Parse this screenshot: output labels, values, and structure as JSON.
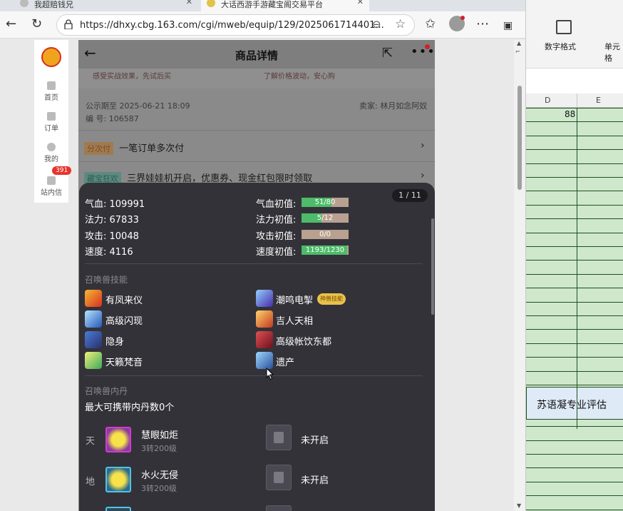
{
  "browser": {
    "tabs": [
      {
        "title": "我超赔钱兄"
      },
      {
        "title": "大话西游手游藏宝阁交易平台"
      }
    ],
    "url": "https://dhxy.cbg.163.com/cgi/mweb/equip/129/2025061714401...",
    "icons": [
      "back-icon",
      "refresh-icon",
      "lock-icon",
      "zoom-icon",
      "star-icon",
      "favorites-icon",
      "profile-icon",
      "more-icon",
      "sidebar-icon"
    ]
  },
  "leftnav": {
    "items": [
      {
        "label": "首页"
      },
      {
        "label": "订单"
      },
      {
        "label": "我的"
      },
      {
        "label": "站内信",
        "badge": "391"
      }
    ]
  },
  "page": {
    "title": "商品详情",
    "banner_left": "感受实战效果，先试后买",
    "banner_right": "了解价格波动，安心购",
    "publicity": "公示期至 2025-06-21 18:09",
    "seller": "卖家: 林月如念阿奴",
    "serial": "编 号: 106587",
    "pay_tag": "分次付",
    "pay_text": "一笔订单多次付",
    "promo_tag": "藏宝狂欢",
    "promo_text": "三界娃娃机开启，优惠券、现金红包限时领取"
  },
  "panel": {
    "counter": "1 / 11",
    "stats": [
      {
        "label": "气血: 109991",
        "init_label": "气血初值:",
        "bar": "51/80",
        "fill": 0.64
      },
      {
        "label": "法力: 67833",
        "init_label": "法力初值:",
        "bar": "5/12",
        "fill": 0.42
      },
      {
        "label": "攻击: 10048",
        "init_label": "攻击初值:",
        "bar": "0/0",
        "fill": 0
      },
      {
        "label": "速度: 4116",
        "init_label": "速度初值:",
        "bar": "1193/1230",
        "fill": 0.97
      }
    ],
    "skills_title": "召唤兽技能",
    "skills": [
      "有凤来仪",
      "潮鸣电掣",
      "高级闪现",
      "吉人天相",
      "隐身",
      "高级帐饮东都",
      "天籁梵音",
      "遗产"
    ],
    "skill_pill": "神兽技能",
    "neidan_title": "召唤兽内丹",
    "neidan_max": "最大可携带内丹数0个",
    "neidan": [
      {
        "row": "天",
        "name": "慧眼如炬",
        "level": "3转200级",
        "locked": "未开启"
      },
      {
        "row": "地",
        "name": "水火无侵",
        "level": "3转200级",
        "locked": "未开启"
      }
    ]
  },
  "sheet": {
    "ribbon_label1": "数字格式",
    "ribbon_label2": "单元格",
    "col_d": "D",
    "col_e": "E",
    "cell_value": "88",
    "merged_cell": "苏语凝专业评估"
  },
  "colors": {
    "green_fill": "#4dbb6a",
    "empty_bar": "#b8a190",
    "panel_bg": "#343239",
    "sheet_green": "#cfe8cc"
  }
}
